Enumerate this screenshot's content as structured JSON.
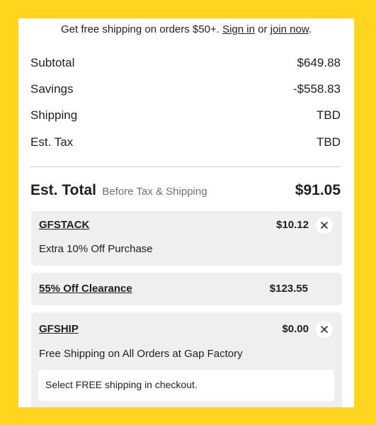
{
  "promo_banner": {
    "text": "Get free shipping on orders $50+.",
    "sign_in_label": "Sign in",
    "or_text": "or",
    "join_label": "join now",
    "period": "."
  },
  "summary": {
    "subtotal_label": "Subtotal",
    "subtotal_value": "$649.88",
    "savings_label": "Savings",
    "savings_value": "-$558.83",
    "shipping_label": "Shipping",
    "shipping_value": "TBD",
    "tax_label": "Est. Tax",
    "tax_value": "TBD"
  },
  "total": {
    "label": "Est. Total",
    "sublabel": "Before Tax & Shipping",
    "value": "$91.05"
  },
  "coupons": [
    {
      "code": "GFSTACK",
      "amount": "$10.12",
      "description": "Extra 10% Off Purchase"
    },
    {
      "code": "55% Off Clearance",
      "amount": "$123.55"
    },
    {
      "code": "GFSHIP",
      "amount": "$0.00",
      "description": "Free Shipping on All Orders at Gap Factory",
      "note": "Select FREE shipping in checkout."
    }
  ],
  "colors": {
    "page_background": "#ffd51e",
    "card_background": "#efefef",
    "text": "#1f1f1f",
    "muted_text": "#707070"
  },
  "icons": {
    "remove": "close-icon"
  }
}
